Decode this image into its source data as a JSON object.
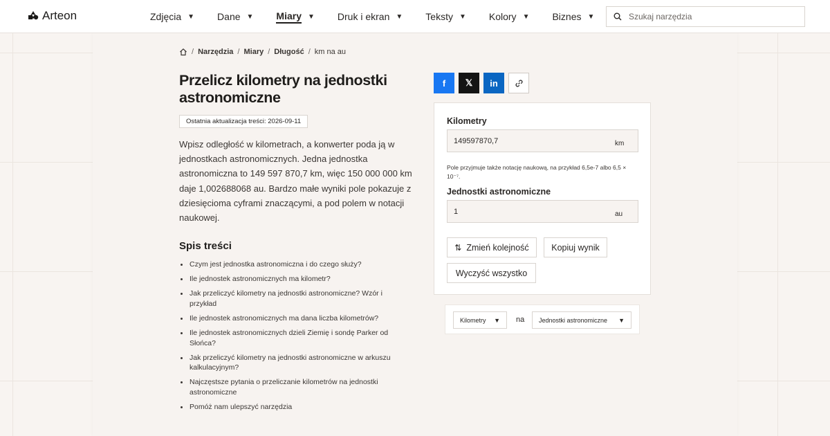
{
  "brand": {
    "name": "Arteon"
  },
  "nav": [
    {
      "label": "Zdjęcia",
      "active": false
    },
    {
      "label": "Dane",
      "active": false
    },
    {
      "label": "Miary",
      "active": true
    },
    {
      "label": "Druk i ekran",
      "active": false
    },
    {
      "label": "Teksty",
      "active": false
    },
    {
      "label": "Kolory",
      "active": false
    },
    {
      "label": "Biznes",
      "active": false
    }
  ],
  "search": {
    "placeholder": "Szukaj narzędzia",
    "icon": "search-icon"
  },
  "breadcrumb": {
    "items": [
      "Narzędzia",
      "Miary",
      "Długość"
    ],
    "current": "km na au",
    "separator": "/"
  },
  "page": {
    "title": "Przelicz kilometry na jednostki astronomiczne",
    "updated": "Ostatnia aktualizacja treści: 2026-09-11",
    "intro": "Wpisz odległość w kilometrach, a konwerter poda ją w jednostkach astronomicznych. Jedna jednostka astronomiczna to 149 597 870,7 km, więc 150 000 000 km daje 1,002688068 au. Bardzo małe wyniki pole pokazuje z dziesięcioma cyframi znaczącymi, a pod polem w notacji naukowej."
  },
  "toc": {
    "heading": "Spis treści",
    "items": [
      "Czym jest jednostka astronomiczna i do czego służy?",
      "Ile jednostek astronomicznych ma kilometr?",
      "Jak przeliczyć kilometry na jednostki astronomiczne? Wzór i przykład",
      "Ile jednostek astronomicznych ma dana liczba kilometrów?",
      "Ile jednostek astronomicznych dzieli Ziemię i sondę Parker od Słońca?",
      "Jak przeliczyć kilometry na jednostki astronomiczne w arkuszu kalkulacyjnym?",
      "Najczęstsze pytania o przeliczanie kilometrów na jednostki astronomiczne",
      "Pomóż nam ulepszyć narzędzia"
    ]
  },
  "share": {
    "facebook": "f",
    "x": "𝕏",
    "linkedin": "in",
    "link_icon": "link-icon"
  },
  "converter": {
    "from": {
      "label": "Kilometry",
      "value": "149597870,7",
      "unit": "km"
    },
    "hint": "Pole przyjmuje także notację naukową, na przykład 6,5e-7 albo 6,5 × 10⁻⁷.",
    "to": {
      "label": "Jednostki astronomiczne",
      "value": "1",
      "unit": "au"
    },
    "buttons": {
      "swap": "Zmień kolejność",
      "copy": "Kopiuj wynik",
      "clear": "Wyczyść wszystko"
    }
  },
  "unit_select": {
    "from": "Kilometry",
    "joiner": "na",
    "to": "Jednostki astronomiczne"
  },
  "colors": {
    "facebook": "#1877f2",
    "x": "#141414",
    "linkedin": "#0a66c2",
    "background": "#f8f4f1"
  }
}
